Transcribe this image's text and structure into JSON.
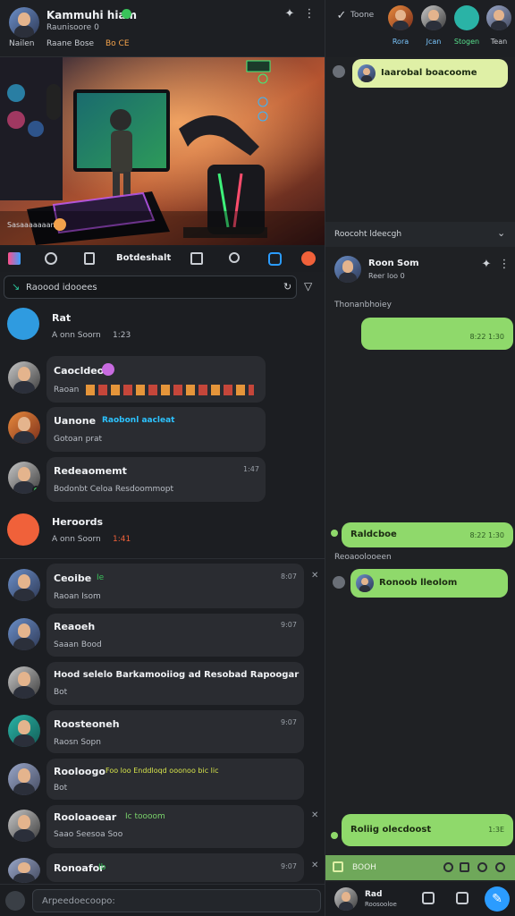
{
  "header": {
    "title": "Kammuhi hiam",
    "status": "Raunisoore 0",
    "subline": "Raane Bose",
    "subline_highlight": "Bo CE",
    "stories": [
      {
        "label": "Rora"
      },
      {
        "label": "Jcan"
      },
      {
        "label": "Stogen"
      },
      {
        "label": "Tean"
      }
    ],
    "right_search": "Toone"
  },
  "hero": {
    "caption": "Sasaaaaaaama"
  },
  "tabbar": {
    "title": "Botdeshalt"
  },
  "search": {
    "placeholder": "Raoood idooees"
  },
  "chats": [
    {
      "name": "Rat",
      "preview": "A onn Soorn",
      "time": "1:23",
      "icon": "chat-bubble-icon",
      "style": "plain"
    },
    {
      "name": "Caocldeo",
      "preview": "Raoan",
      "time": "",
      "icon": "avatar",
      "style": "bubble"
    },
    {
      "name": "Uanone",
      "name_accent": "Raobonl aacleat",
      "preview": "Gotoan prat",
      "time": "",
      "style": "bubble"
    },
    {
      "name": "Redeaomemt",
      "preview": "Bodonbt Celoa Resdoommopt",
      "time": "1:47",
      "style": "bubble"
    },
    {
      "name": "Heroords",
      "preview": "A onn Soorn",
      "time": "1:41",
      "icon": "fire-icon",
      "style": "plain"
    },
    {
      "name": "Ceoibe",
      "name_accent": "Ie",
      "preview": "Raoan Isom",
      "time": "8:07",
      "style": "bubble"
    },
    {
      "name": "Reaoeh",
      "preview": "Saaan Bood",
      "time": "9:07",
      "style": "bubble"
    },
    {
      "name": "Hood selelo Barkamooiiog ad Resobad Rapoogar",
      "preview": "Bot",
      "time": "",
      "style": "bubble"
    },
    {
      "name": "Roosteoneh",
      "preview": "Raosn Sopn",
      "time": "9:07",
      "style": "bubble"
    },
    {
      "name": "Rooloogo",
      "name_accent": "Foo loo Enddloqd ooonoo bic lic",
      "preview": "Bot",
      "time": "",
      "style": "bubble"
    },
    {
      "name": "Rooloaoear",
      "name_accent": "Ic toooom",
      "preview": "Saao Seesoa Soo",
      "time": "",
      "style": "bubble"
    },
    {
      "name": "Ronoafor",
      "name_accent": "Ib",
      "preview": "",
      "time": "9:07",
      "style": "bubble"
    }
  ],
  "composer": {
    "placeholder": "Arpeedoecoopo:"
  },
  "right_panel": {
    "msg1": "Iaarobal boacoome",
    "divider_title": "Roocoht ldeecgh",
    "contact_name": "Roon Som",
    "contact_status": "Reer Ioo 0",
    "date_label": "Thonanbhoiey",
    "msg2_meta": "8:22 1:30",
    "msg3": "Raldcboe",
    "msg3_meta": "8:22 1:30",
    "section2": "Reoaoolooeen",
    "msg4": "Ronoob lleolom",
    "msg5": "Roliig olecdoost",
    "msg5_meta": "1:3E",
    "input_placeholder": "BOOH",
    "bottom_name": "Rad",
    "bottom_sub": "Roosooloe"
  },
  "colors": {
    "accent": "#2b9cff",
    "bubble_green": "#8fd96b",
    "online": "#39c25a",
    "orange": "#f0613a"
  }
}
